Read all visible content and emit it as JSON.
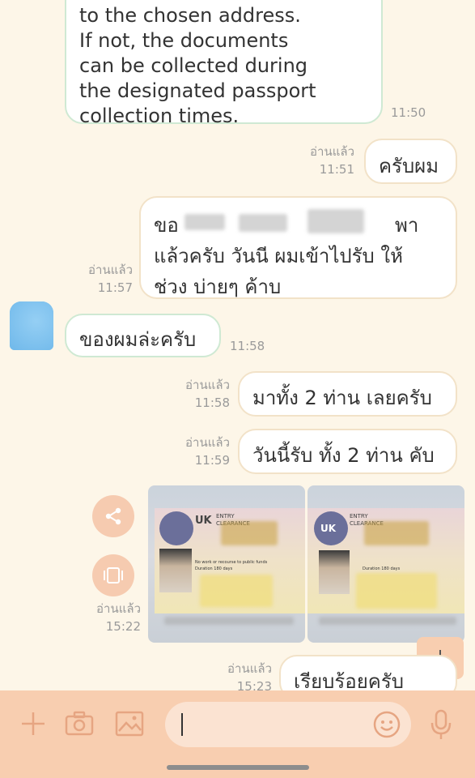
{
  "messages": {
    "m1": {
      "lines": [
        "to the chosen address.",
        "If not, the documents",
        "can be collected during",
        "the designated passport",
        "collection times."
      ],
      "time": "11:50"
    },
    "m2": {
      "read": "อ่านแล้ว",
      "time": "11:51",
      "text": "ครับผม"
    },
    "m3": {
      "read": "อ่านแล้ว",
      "time": "11:57",
      "line1": "ขอ",
      "line1b": "พา",
      "line2": "แล้วครับ วันนี ผมเข้าไปรับ ให้",
      "line3": "ช่วง บ่ายๆ ค้าบ"
    },
    "m4": {
      "text": "ของผมล่ะครับ",
      "time": "11:58"
    },
    "m5": {
      "read": "อ่านแล้ว",
      "time": "11:58",
      "text": "มาทั้ง 2 ท่าน เลยครับ"
    },
    "m6": {
      "read": "อ่านแล้ว",
      "time": "11:59",
      "text": "วันนี้รับ ทั้ง 2 ท่าน คับ"
    },
    "m7": {
      "read": "อ่านแล้ว",
      "time": "15:22",
      "photo1": {
        "brand": "UK",
        "sub": "ENTRY\nCLEARANCE",
        "note1": "No work or recourse to public funds",
        "note2": "Duration 180 days"
      },
      "photo2": {
        "brand": "UK",
        "sub": "ENTRY\nCLEARANCE",
        "note1": "Duration 180 days"
      }
    },
    "m8": {
      "read": "อ่านแล้ว",
      "time": "15:23",
      "text": "เรียบร้อยครับ"
    }
  },
  "input": {
    "placeholder": ""
  },
  "colors": {
    "background": "#fdf6e8",
    "accent": "#f8ceb0",
    "incoming_border": "#cfe9d3",
    "outgoing_border": "#f2e2c8",
    "avatar": "#7fc3ee"
  },
  "icons": [
    "share-icon",
    "repost-icon",
    "scroll-down-icon",
    "plus-icon",
    "camera-icon",
    "image-icon",
    "emoji-icon",
    "microphone-icon"
  ]
}
